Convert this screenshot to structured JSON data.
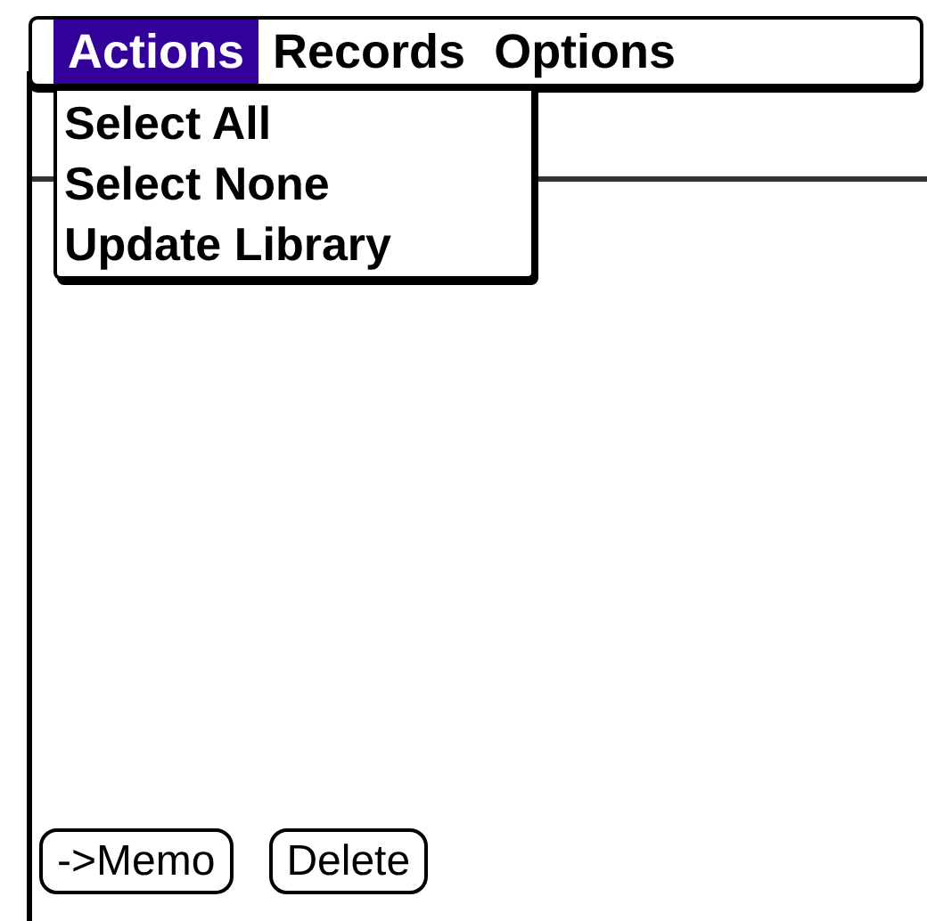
{
  "menu_bar": [
    {
      "label": "Actions",
      "selected": true
    },
    {
      "label": "Records",
      "selected": false
    },
    {
      "label": "Options",
      "selected": false
    }
  ],
  "dropdown": {
    "items": [
      "Select All",
      "Select None",
      "Update Library"
    ]
  },
  "buttons": [
    "->Memo",
    "Delete"
  ]
}
